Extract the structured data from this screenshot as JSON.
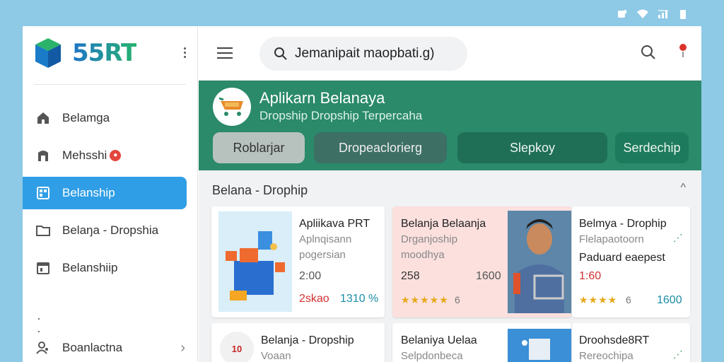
{
  "sidebar": {
    "logo": "55RT",
    "items": [
      {
        "label": "Belamga",
        "icon": "home-icon"
      },
      {
        "label": "Mehsshi",
        "icon": "store-icon",
        "badge": "●"
      },
      {
        "label": "Belanship",
        "icon": "grid-icon",
        "active": true
      },
      {
        "label": "Belaŋa - Dropshia",
        "icon": "folder-icon"
      },
      {
        "label": "Belanshiip",
        "icon": "calendar-icon"
      }
    ],
    "bottom_item": {
      "label": "Boanlactna",
      "icon": "users-icon"
    }
  },
  "topbar": {
    "search_text": "Jemanipait maopbati.g)"
  },
  "banner": {
    "title": "Aplikarn Belanaya",
    "subtitle": "Dropship Dropship Terpercaha",
    "chips": [
      "Roblarjar",
      "Dropeaclorierg",
      "Slepkoy",
      "Serdechip"
    ]
  },
  "section": {
    "title": "Belana - Drophip"
  },
  "cards": [
    {
      "title": "Apliikava PRT",
      "sub1": "Aplnqisann",
      "sub2": "pogersian",
      "price": "2:00",
      "price_red": "2skao",
      "price_teal": "1310 %"
    },
    {
      "title": "Belanja Belaanja",
      "sub1": "Drganjoship",
      "sub2": "moodhya",
      "price1": "258",
      "price2": "1600",
      "rating": "6"
    },
    {
      "title": "Belmya - Drophip",
      "sub1": "Flelapaotoorn",
      "emph": "Paduard eaepest",
      "price_red": "1:60",
      "rating": "6",
      "price2": "1600"
    },
    {
      "title": "Belanja - Dropship",
      "sub1": "Voaan",
      "thumb_text": "10"
    },
    {
      "title": "Belaniya Uelaa",
      "sub1": "Selpdonbeca"
    },
    {
      "title": "Droohsde8RT",
      "sub1": "Rereochipa"
    }
  ],
  "colors": {
    "accent": "#2f9ee6",
    "banner": "#2a8a6a",
    "bg": "#8ec9e6"
  }
}
